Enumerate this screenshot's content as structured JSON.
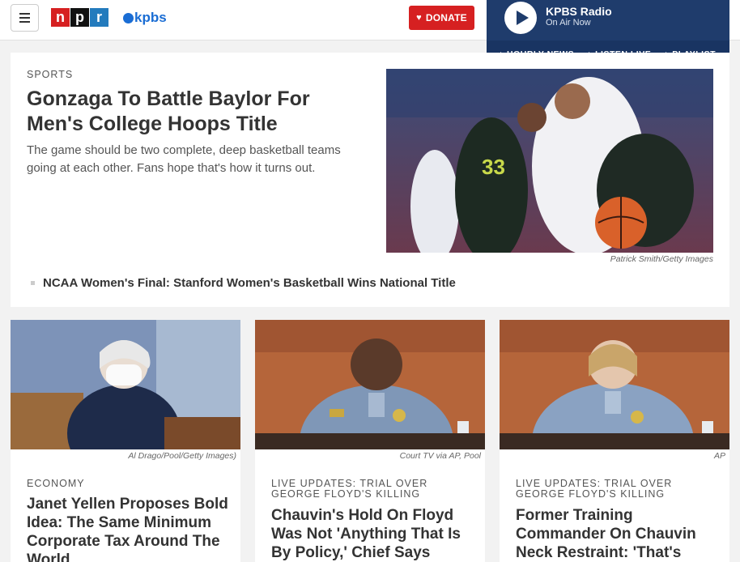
{
  "header": {
    "station": "kpbs",
    "npr_letters": [
      "n",
      "p",
      "r"
    ],
    "donate_label": "DONATE",
    "colors": {
      "npr_red": "#d62021",
      "npr_blue": "#237bbd",
      "station_blue": "#1a6dd4"
    }
  },
  "player": {
    "title": "KPBS Radio",
    "subtitle": "On Air Now",
    "links": [
      "HOURLY NEWS",
      "LISTEN LIVE",
      "PLAYLIST"
    ],
    "bg": "#1f3c6c"
  },
  "featured": {
    "slug": "SPORTS",
    "title": "Gonzaga To Battle Baylor For Men's College Hoops Title",
    "teaser": "The game should be two complete, deep basketball teams going at each other. Fans hope that's how it turns out.",
    "credit": "Patrick Smith/Getty Images",
    "related": "NCAA Women's Final: Stanford Women's Basketball Wins National Title"
  },
  "cards": [
    {
      "slug": "ECONOMY",
      "title": "Janet Yellen Proposes Bold Idea: The Same Minimum Corporate Tax Around The World",
      "credit": "Al Drago/Pool/Getty Images)"
    },
    {
      "slug": "LIVE UPDATES: TRIAL OVER GEORGE FLOYD'S KILLING",
      "title": "Chauvin's Hold On Floyd Was Not 'Anything That Is By Policy,' Chief Says",
      "credit": "Court TV via AP, Pool"
    },
    {
      "slug": "LIVE UPDATES: TRIAL OVER GEORGE FLOYD'S KILLING",
      "title": "Former Training Commander On Chauvin Neck Restraint: 'That's",
      "credit": "AP"
    }
  ]
}
